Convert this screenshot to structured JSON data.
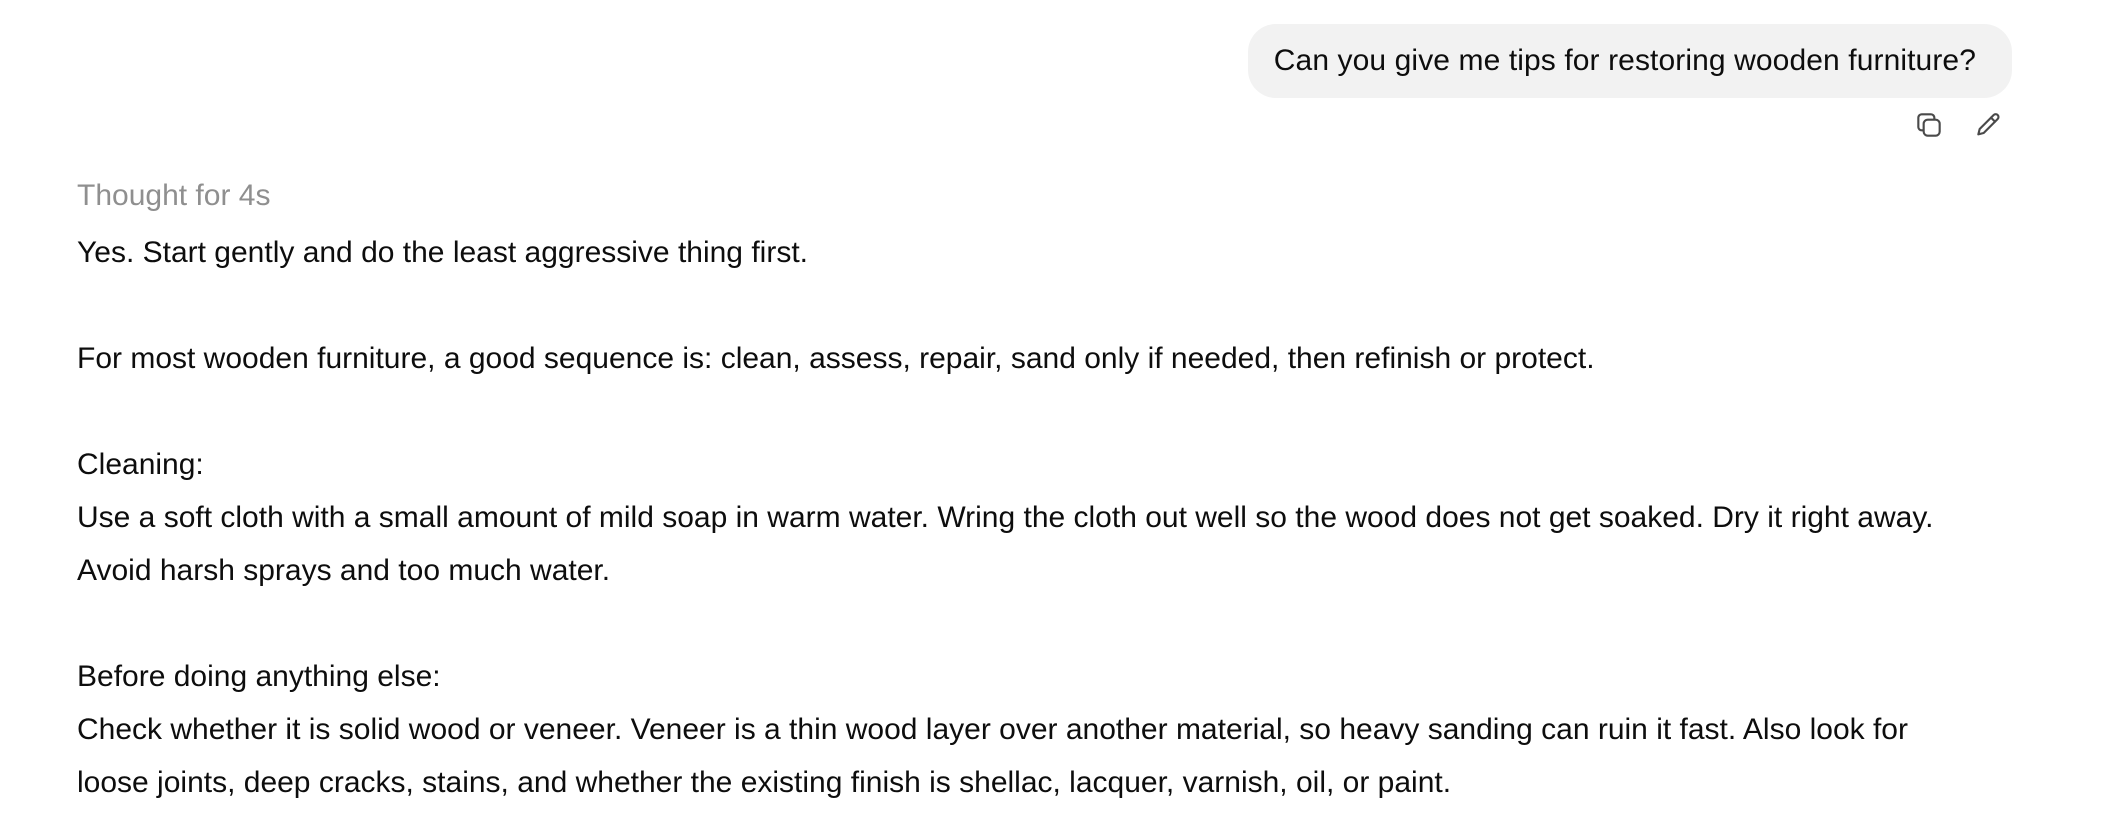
{
  "user_message": {
    "text": "Can you give me tips for restoring wooden furniture?",
    "actions": [
      {
        "name": "copy",
        "icon": "copy-icon"
      },
      {
        "name": "edit",
        "icon": "pencil-icon"
      }
    ]
  },
  "assistant": {
    "thought_label": "Thought for 4s",
    "paragraphs": {
      "intro": "Yes. Start gently and do the least aggressive thing first.",
      "sequence": "For most wooden furniture, a good sequence is: clean, assess, repair, sand only if needed, then refinish or protect.",
      "cleaning_heading": "Cleaning:",
      "cleaning_body": "Use a soft cloth with a small amount of mild soap in warm water. Wring the cloth out well so the wood does not get soaked. Dry it right away. Avoid harsh sprays and too much water.",
      "before_heading": "Before doing anything else:",
      "before_body": "Check whether it is solid wood or veneer. Veneer is a thin wood layer over another material, so heavy sanding can ruin it fast. Also look for loose joints, deep cracks, stains, and whether the existing finish is shellac, lacquer, varnish, oil, or paint."
    }
  }
}
